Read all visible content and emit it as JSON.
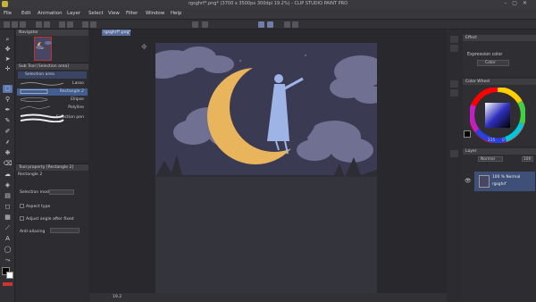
{
  "titlebar": {
    "title": "rgsghrf*.png* (3700 x 3500px 300dpi 19.2%) - CLIP STUDIO PAINT PRO"
  },
  "menu": {
    "items": [
      "File",
      "Edit",
      "Animation",
      "Layer",
      "Select",
      "View",
      "Filter",
      "Window",
      "Help"
    ]
  },
  "document": {
    "tab_label": "rgsghrf*.png*"
  },
  "navigator": {
    "title": "Navigator"
  },
  "subtool": {
    "header": "Sub Tool [Selection area]",
    "group": "Selection area",
    "items": [
      "Lasso",
      "Rectangle 2",
      "Ellipse",
      "Polyline",
      "Selection pen"
    ]
  },
  "toolprop": {
    "header": "Tool property [Rectangle 2]",
    "name": "Rectangle 2",
    "selection_mode": "Selection mode",
    "aspect_type": "Aspect type",
    "adjust_angle": "Adjust angle after fixed",
    "anti_aliasing": "Anti-aliasing"
  },
  "status": {
    "zoom": "19.2"
  },
  "effect": {
    "title": "Effect",
    "expression_color": "Expression color",
    "color_value": "Color"
  },
  "colorwheel": {
    "title": "Color Wheel",
    "h": "235",
    "v": "0"
  },
  "layers": {
    "title": "Layer",
    "blend": "Normal",
    "opacity": "100",
    "layer_percent": "100 % Normal",
    "layer_name": "rgsghrf"
  },
  "colors": {
    "accent": "#5876ad",
    "canvas_bg": "#34343d",
    "moon": "#e8b45c",
    "cloud": "#6f7092",
    "figure": "#9fb4e6"
  }
}
